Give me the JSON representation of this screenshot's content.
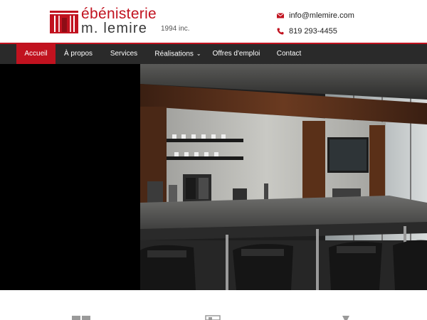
{
  "brand": {
    "name_line1": "ébénisterie",
    "name_line2": "m. lemire",
    "name_sub": "1994 inc.",
    "accent_color": "#c1121f",
    "mark_icon": "logo-mark"
  },
  "contact": {
    "email": "info@mlemire.com",
    "phone": "819 293-4455",
    "email_icon": "envelope-icon",
    "phone_icon": "phone-icon"
  },
  "nav": {
    "items": [
      {
        "label": "Accueil",
        "active": true
      },
      {
        "label": "À propos"
      },
      {
        "label": "Services"
      },
      {
        "label": "Réalisations",
        "has_dropdown": true
      },
      {
        "label": "Offres d'emploi"
      },
      {
        "label": "Contact"
      }
    ],
    "bar_color": "#2a2a2a"
  },
  "hero": {
    "image_desc": "kitchen-bar-photo"
  }
}
